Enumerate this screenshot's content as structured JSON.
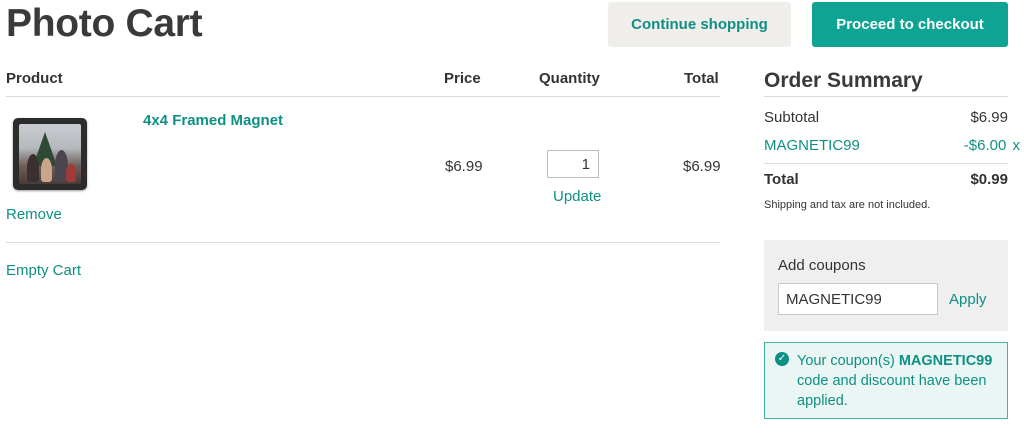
{
  "header": {
    "title": "Photo Cart",
    "continue_label": "Continue shopping",
    "checkout_label": "Proceed to checkout"
  },
  "cart": {
    "columns": {
      "product": "Product",
      "price": "Price",
      "quantity": "Quantity",
      "total": "Total"
    },
    "items": [
      {
        "name": "4x4 Framed Magnet",
        "price": "$6.99",
        "quantity": "1",
        "total": "$6.99",
        "update_label": "Update",
        "remove_label": "Remove",
        "thumbnail_icon": "photo-thumbnail"
      }
    ],
    "empty_label": "Empty Cart"
  },
  "summary": {
    "title": "Order Summary",
    "subtotal_label": "Subtotal",
    "subtotal_value": "$6.99",
    "coupon_code": "MAGNETIC99",
    "coupon_discount": "-$6.00",
    "coupon_remove": "x",
    "total_label": "Total",
    "total_value": "$0.99",
    "note": "Shipping and tax are not included."
  },
  "coupon": {
    "heading": "Add coupons",
    "input_value": "MAGNETIC99",
    "apply_label": "Apply",
    "notice_prefix": "Your coupon(s) ",
    "notice_code": "MAGNETIC99",
    "notice_suffix": " code and discount have been applied."
  },
  "colors": {
    "accent": "#0f8f84",
    "checkout_bg": "#0fa394",
    "continue_bg": "#f0eeeb",
    "coupon_bg": "#efefef",
    "notice_bg": "#eaf6f4"
  }
}
